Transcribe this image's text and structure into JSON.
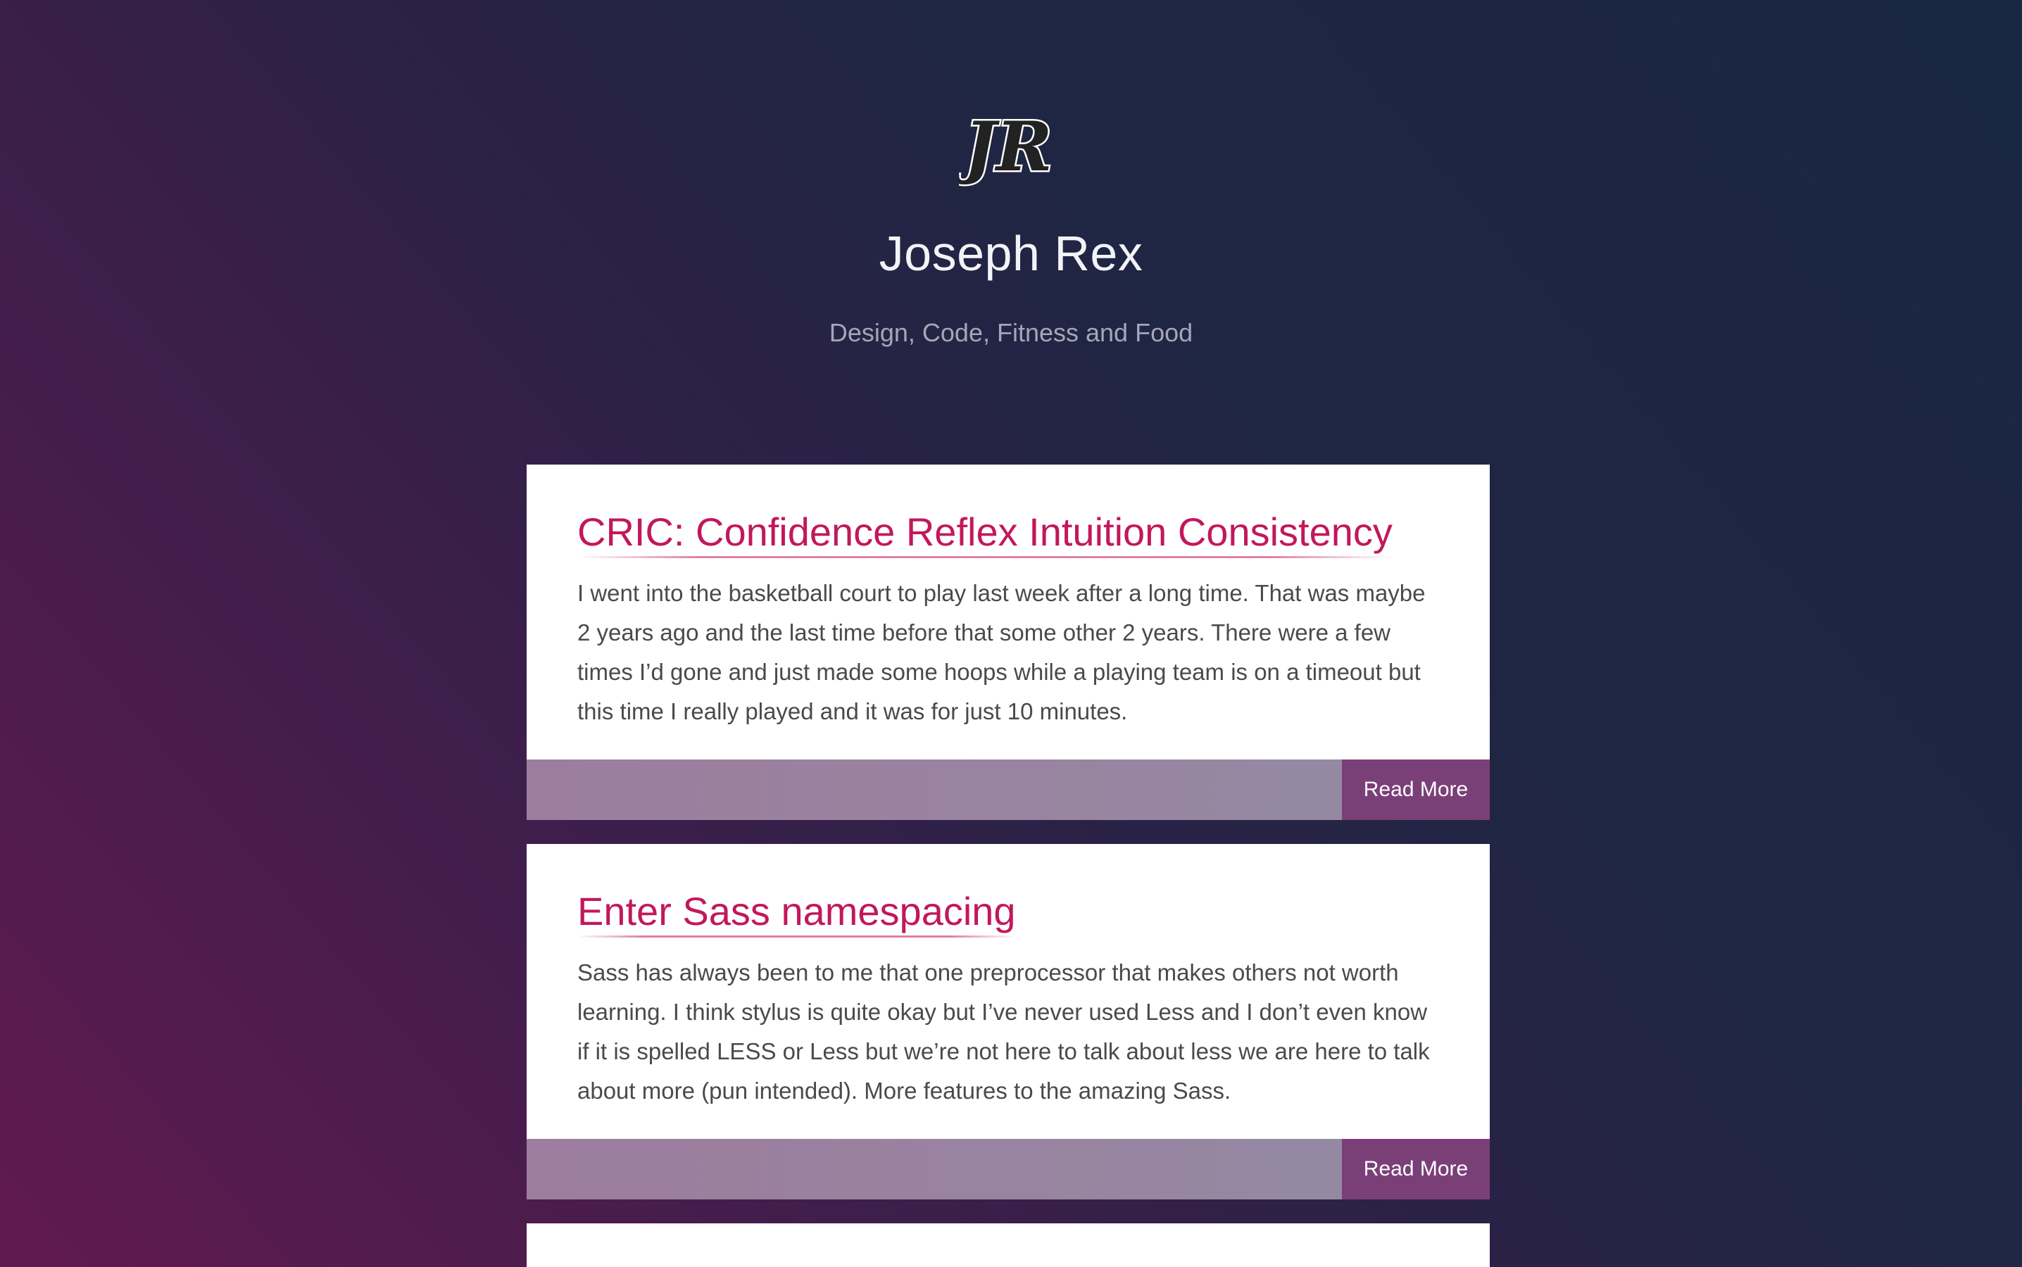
{
  "site": {
    "logo_text": "JR",
    "title": "Joseph Rex",
    "tagline": "Design, Code, Fitness and Food"
  },
  "posts": [
    {
      "title": "CRIC: Confidence Reflex Intuition Consistency",
      "excerpt": "I went into the basketball court to play last week after a long time. That was maybe 2 years ago and the last time before that some other 2 years. There were a few times I’d gone and just made some hoops while a playing team is on a timeout but this time I really played and it was for just 10 minutes.",
      "read_more": "Read More"
    },
    {
      "title": "Enter Sass namespacing",
      "excerpt": "Sass has always been to me that one preprocessor that makes others not worth learning. I think stylus is quite okay but I’ve never used Less and I don’t even know if it is spelled LESS or Less but we’re not here to talk about less we are here to talk about more (pun intended). More features to the amazing Sass.",
      "read_more": "Read More"
    }
  ],
  "colors": {
    "accent": "#c2185b",
    "button": "#7b3f78",
    "background_top": "#1a2742",
    "background_bottom": "#621a4e"
  }
}
